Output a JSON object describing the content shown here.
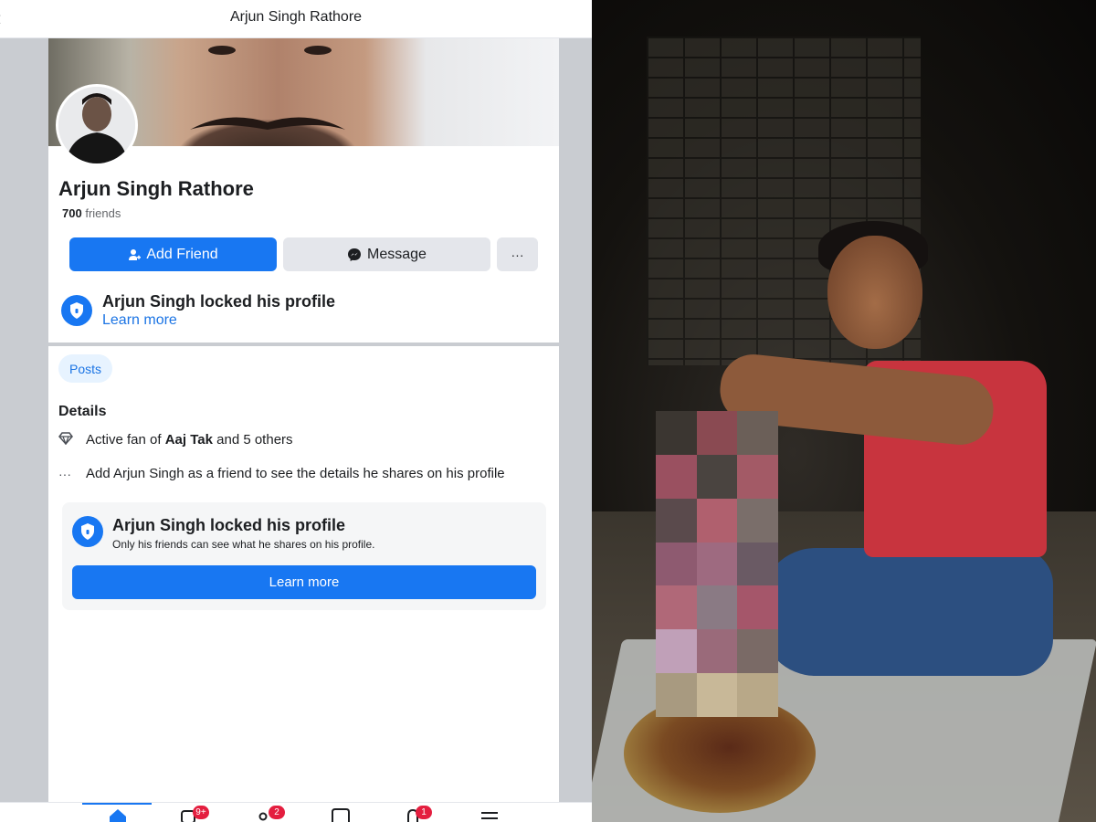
{
  "header": {
    "back_glyph": "‹",
    "title": "Arjun Singh Rathore"
  },
  "profile": {
    "name": "Arjun Singh Rathore",
    "friends_count": "700",
    "friends_label": "friends"
  },
  "actions": {
    "add_friend": "Add Friend",
    "message": "Message",
    "more": "···"
  },
  "locked_banner": {
    "title": "Arjun Singh locked his profile",
    "link": "Learn more"
  },
  "tabs": {
    "posts": "Posts"
  },
  "details": {
    "heading": "Details",
    "fan_prefix": "Active fan of ",
    "fan_page": "Aaj Tak",
    "fan_suffix": " and 5 others",
    "friend_hint": "Add Arjun Singh as a friend to see the details he shares on his profile"
  },
  "locked_card": {
    "title": "Arjun Singh locked his profile",
    "subtitle": "Only his friends can see what he shares on his profile.",
    "button": "Learn more"
  },
  "bottom_nav": {
    "items": [
      {
        "icon": "home-icon",
        "badge": ""
      },
      {
        "icon": "video-icon",
        "badge": "9+"
      },
      {
        "icon": "friends-icon",
        "badge": "2"
      },
      {
        "icon": "marketplace-icon",
        "badge": ""
      },
      {
        "icon": "notifications-icon",
        "badge": "1"
      },
      {
        "icon": "menu-icon",
        "badge": ""
      }
    ]
  },
  "colors": {
    "accent": "#1877f2",
    "badge": "#e41e3f",
    "link": "#1b74e4",
    "shirt": "#c8343e"
  }
}
